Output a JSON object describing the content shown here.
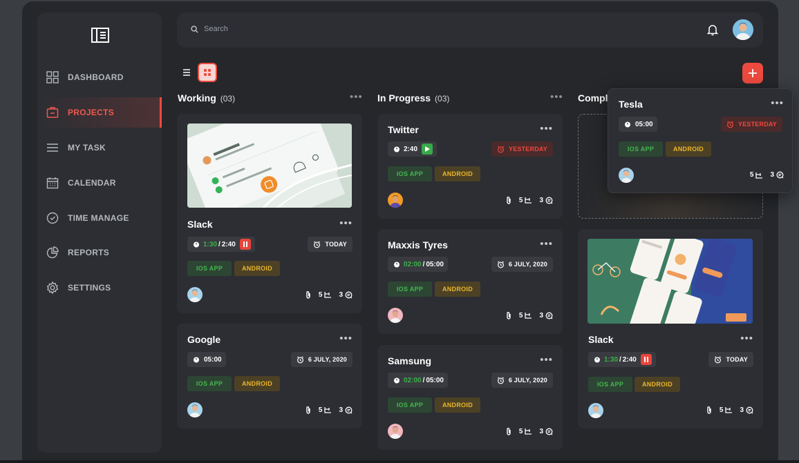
{
  "search": {
    "placeholder": "Search"
  },
  "sidebar": {
    "items": [
      {
        "label": "DASHBOARD",
        "icon": "grid-icon"
      },
      {
        "label": "PROJECTS",
        "icon": "briefcase-icon",
        "active": true
      },
      {
        "label": "MY TASK",
        "icon": "list-icon"
      },
      {
        "label": "CALENDAR",
        "icon": "calendar-icon"
      },
      {
        "label": "TIME MANAGE",
        "icon": "clock-icon"
      },
      {
        "label": "REPORTS",
        "icon": "pie-chart-icon"
      },
      {
        "label": "SETTINGS",
        "icon": "gear-icon"
      }
    ]
  },
  "colors": {
    "accent": "#ec4a3f",
    "ios": "#44b64f",
    "android": "#eab72c",
    "card": "#2c2e33"
  },
  "columns": [
    {
      "title": "Working",
      "count": "(03)"
    },
    {
      "title": "In Progress",
      "count": "(03)"
    },
    {
      "title": "Compl"
    }
  ],
  "tags": {
    "ios": "IOS APP",
    "android": "ANDROID"
  },
  "meta": {
    "subtasks": "5",
    "comments": "3"
  },
  "cards": {
    "slack1": {
      "title": "Slack",
      "timer_elapsed": "1:30",
      "timer_total": "2:40",
      "due": "TODAY"
    },
    "google": {
      "title": "Google",
      "timer": "05:00",
      "due": "6 JULY, 2020"
    },
    "twitter": {
      "title": "Twitter",
      "timer": "2:40",
      "due": "YESTERDAY"
    },
    "maxxis": {
      "title": "Maxxis Tyres",
      "timer_elapsed": "02:00",
      "timer_total": "05:00",
      "due": "6 JULY, 2020"
    },
    "samsung": {
      "title": "Samsung",
      "timer_elapsed": "02:00",
      "timer_total": "05:00",
      "due": "6 JULY, 2020"
    },
    "slack2": {
      "title": "Slack",
      "timer_elapsed": "1:30",
      "timer_total": "2:40",
      "due": "TODAY"
    },
    "tesla": {
      "title": "Tesla",
      "timer": "05:00",
      "due": "YESTERDAY"
    }
  }
}
